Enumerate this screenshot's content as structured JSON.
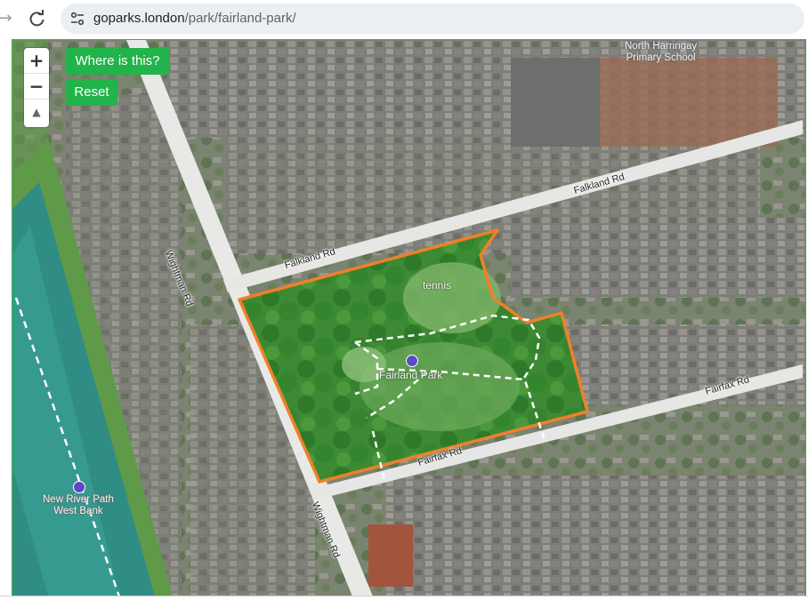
{
  "browser": {
    "url_host": "goparks.london",
    "url_path": "/park/fairland-park/"
  },
  "controls": {
    "zoom_in": "+",
    "zoom_out": "−",
    "compass": "▲",
    "where_label": "Where is this?",
    "reset_label": "Reset"
  },
  "map": {
    "roads": [
      "Wightman Rd",
      "Falkland Rd",
      "Fairfax Rd"
    ],
    "labels": {
      "school_line1": "North Harringay",
      "school_line2": "Primary School",
      "tennis": "tennis",
      "park": "Fairland Park",
      "path_line1": "New River Path",
      "path_line2": "West Bank"
    },
    "colors": {
      "park_outline": "#f0802a",
      "park_fill": "#3f9a35",
      "button": "#22b34a",
      "river": "#2f8d86"
    }
  }
}
